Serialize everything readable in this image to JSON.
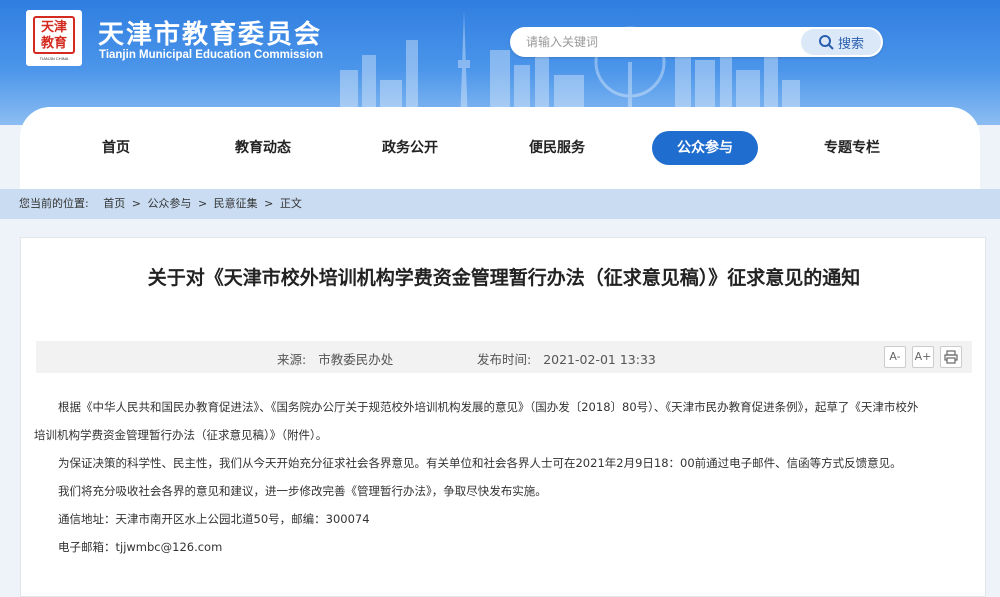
{
  "header": {
    "logo_text": "天津教育",
    "logo_sub": "TIANJIN CHINA",
    "title": "天津市教育委员会",
    "subtitle": "Tianjin Municipal Education Commission",
    "search_placeholder": "请输入关键词",
    "search_button": "搜索"
  },
  "nav": {
    "items": [
      {
        "label": "首页"
      },
      {
        "label": "教育动态"
      },
      {
        "label": "政务公开"
      },
      {
        "label": "便民服务"
      },
      {
        "label": "公众参与"
      },
      {
        "label": "专题专栏"
      }
    ],
    "active_index": 4
  },
  "breadcrumb": {
    "prefix": "您当前的位置:",
    "items": [
      "首页",
      "公众参与",
      "民意征集",
      "正文"
    ],
    "sep": ">"
  },
  "article": {
    "title": "关于对《天津市校外培训机构学费资金管理暂行办法（征求意见稿）》征求意见的通知",
    "source_label": "来源:",
    "source": "市教委民办处",
    "time_label": "发布时间:",
    "time": "2021-02-01 13:33",
    "tools": [
      "A-",
      "A+",
      "print"
    ],
    "paragraphs": {
      "p1a": "根据《中华人民共和国民办教育促进法》、《国务院办公厅关于规范校外培训机构发展的意见》（国办发〔2018〕80号）、《天津市民办教育促进条例》，起草了《天津市校外",
      "p1b": "培训机构学费资金管理暂行办法（征求意见稿）》（附件）。",
      "p2": "为保证决策的科学性、民主性，我们从今天开始充分征求社会各界意见。有关单位和社会各界人士可在2021年2月9日18：00前通过电子邮件、信函等方式反馈意见。",
      "p3": "我们将充分吸收社会各界的意见和建议，进一步修改完善《管理暂行办法》，争取尽快发布实施。",
      "p4": "通信地址：天津市南开区水上公园北道50号，邮编：300074",
      "p5": "电子邮箱：tjjwmbc@126.com"
    }
  },
  "colors": {
    "header_blue": "#2f7ee0",
    "nav_active": "#1f6ecf",
    "crumb_bg": "#c9dcf2"
  }
}
